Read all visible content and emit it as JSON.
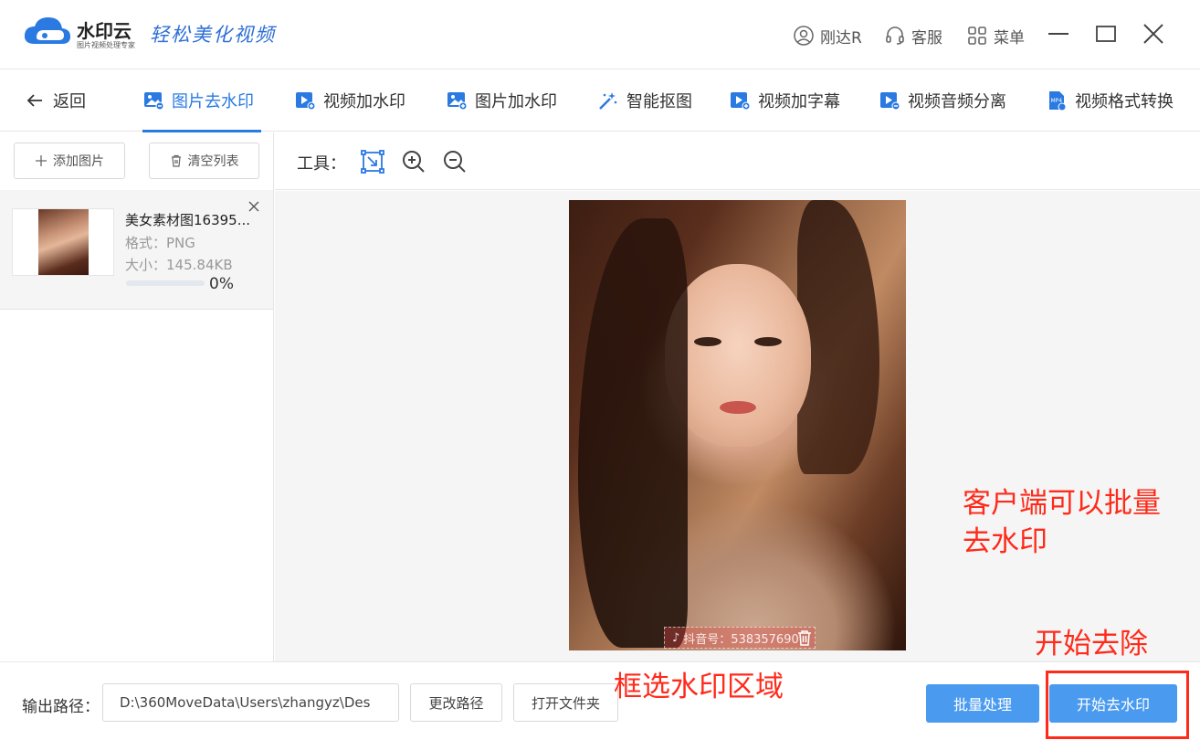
{
  "titlebar": {
    "brand": "水印云",
    "brand_sub": "图片视频处理专家",
    "slogan": "轻松美化视频",
    "user": "刚达R",
    "service": "客服",
    "menu": "菜单"
  },
  "nav": {
    "back": "返回",
    "tabs": [
      {
        "label": "图片去水印",
        "icon": "image-icon"
      },
      {
        "label": "视频加水印",
        "icon": "video-icon"
      },
      {
        "label": "图片加水印",
        "icon": "image-add-icon"
      },
      {
        "label": "智能抠图",
        "icon": "magic-wand-icon"
      },
      {
        "label": "视频加字幕",
        "icon": "video-subtitle-icon"
      },
      {
        "label": "视频音频分离",
        "icon": "video-audio-icon"
      },
      {
        "label": "视频格式转换",
        "icon": "mp4-icon"
      }
    ],
    "active_tab": 0
  },
  "left_panel": {
    "add_button": "添加图片",
    "clear_button": "清空列表",
    "files": [
      {
        "name": "美女素材图16395...",
        "format": "格式：PNG",
        "size": "大小：145.84KB",
        "progress": 0,
        "percent": "0%"
      }
    ]
  },
  "toolbar": {
    "label": "工具："
  },
  "canvas": {
    "watermark_text": "抖音号：538357690"
  },
  "annotations": {
    "batch_note_line1": "客户端可以批量",
    "batch_note_line2": "去水印",
    "select_note": "框选水印区域",
    "start_note": "开始去除"
  },
  "bottom": {
    "output_label": "输出路径：",
    "output_path": "D:\\360MoveData\\Users\\zhangyz\\Des",
    "change_path": "更改路径",
    "open_folder": "打开文件夹",
    "batch_button": "批量处理",
    "start_button": "开始去水印"
  },
  "colors": {
    "accent": "#2a7ae2",
    "primary_button": "#4a9bef",
    "annotation": "#ff2a1a"
  }
}
